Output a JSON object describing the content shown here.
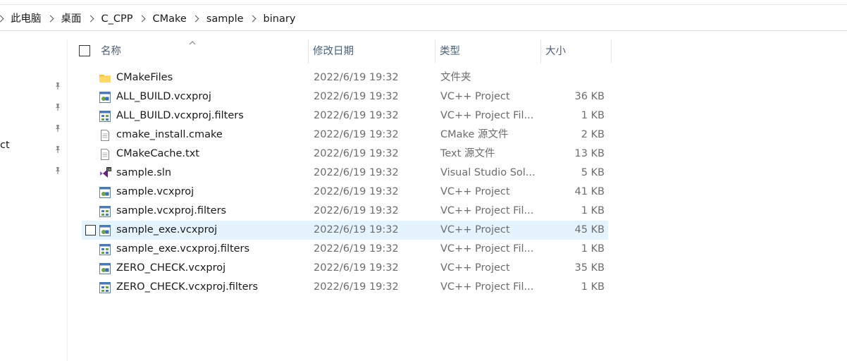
{
  "breadcrumb": [
    "此电脑",
    "桌面",
    "C_CPP",
    "CMake",
    "sample",
    "binary"
  ],
  "nav": {
    "partial_label": "ct"
  },
  "columns": {
    "name": "名称",
    "date": "修改日期",
    "type": "类型",
    "size": "大小"
  },
  "files": [
    {
      "name": "CMakeFiles",
      "date": "2022/6/19 19:32",
      "type": "文件夹",
      "size": "",
      "icon": "folder-icon"
    },
    {
      "name": "ALL_BUILD.vcxproj",
      "date": "2022/6/19 19:32",
      "type": "VC++ Project",
      "size": "36 KB",
      "icon": "vcxproj-icon"
    },
    {
      "name": "ALL_BUILD.vcxproj.filters",
      "date": "2022/6/19 19:32",
      "type": "VC++ Project Fil...",
      "size": "1 KB",
      "icon": "filters-icon"
    },
    {
      "name": "cmake_install.cmake",
      "date": "2022/6/19 19:32",
      "type": "CMake 源文件",
      "size": "2 KB",
      "icon": "document-icon"
    },
    {
      "name": "CMakeCache.txt",
      "date": "2022/6/19 19:32",
      "type": "Text 源文件",
      "size": "13 KB",
      "icon": "document-icon"
    },
    {
      "name": "sample.sln",
      "date": "2022/6/19 19:32",
      "type": "Visual Studio Sol...",
      "size": "5 KB",
      "icon": "visual-studio-icon"
    },
    {
      "name": "sample.vcxproj",
      "date": "2022/6/19 19:32",
      "type": "VC++ Project",
      "size": "41 KB",
      "icon": "vcxproj-icon"
    },
    {
      "name": "sample.vcxproj.filters",
      "date": "2022/6/19 19:32",
      "type": "VC++ Project Fil...",
      "size": "1 KB",
      "icon": "filters-icon"
    },
    {
      "name": "sample_exe.vcxproj",
      "date": "2022/6/19 19:32",
      "type": "VC++ Project",
      "size": "45 KB",
      "icon": "vcxproj-icon",
      "selected": true
    },
    {
      "name": "sample_exe.vcxproj.filters",
      "date": "2022/6/19 19:32",
      "type": "VC++ Project Fil...",
      "size": "1 KB",
      "icon": "filters-icon"
    },
    {
      "name": "ZERO_CHECK.vcxproj",
      "date": "2022/6/19 19:32",
      "type": "VC++ Project",
      "size": "35 KB",
      "icon": "vcxproj-icon"
    },
    {
      "name": "ZERO_CHECK.vcxproj.filters",
      "date": "2022/6/19 19:32",
      "type": "VC++ Project Fil...",
      "size": "1 KB",
      "icon": "filters-icon"
    }
  ],
  "colors": {
    "header_text": "#4c607a",
    "selection": "#e5f3ff",
    "folder": "#f5c542",
    "vs_purple": "#865fc5"
  }
}
